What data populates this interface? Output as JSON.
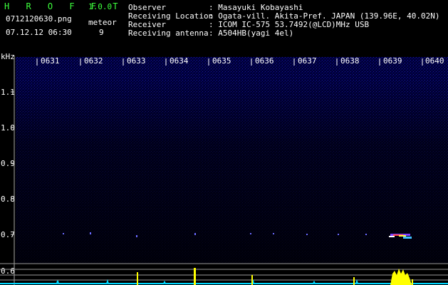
{
  "app": {
    "name": "H R O F F T",
    "version": "1.0.0",
    "file": "0712120630.png",
    "timestamp": "07.12.12 06:30",
    "meteor_label": "meteor",
    "meteor_count": "9"
  },
  "info": {
    "labels": [
      "Observer",
      "Receiving Location",
      "Receiver",
      "Receiving antenna"
    ],
    "values": [
      ": Masayuki Kobayashi",
      ": Ogata-vill. Akita-Pref. JAPAN (139.96E, 40.02N)",
      ": ICOM IC-575 53.7492(@LCD)MHz USB",
      ": A504HB(yagi 4el)"
    ]
  },
  "spectrogram": {
    "unit": "kHz",
    "time_ticks": [
      "0631",
      "0632",
      "0633",
      "0634",
      "0635",
      "0636",
      "0637",
      "0638",
      "0639",
      "0640"
    ],
    "freq_ticks": [
      "1.1",
      "1.0",
      "0.9",
      "0.8",
      "0.7",
      "0.6"
    ],
    "colors": {
      "background": "#00006a",
      "grid": "#888888",
      "echo": "#ffff00",
      "baseline": "#00e0ff"
    }
  }
}
